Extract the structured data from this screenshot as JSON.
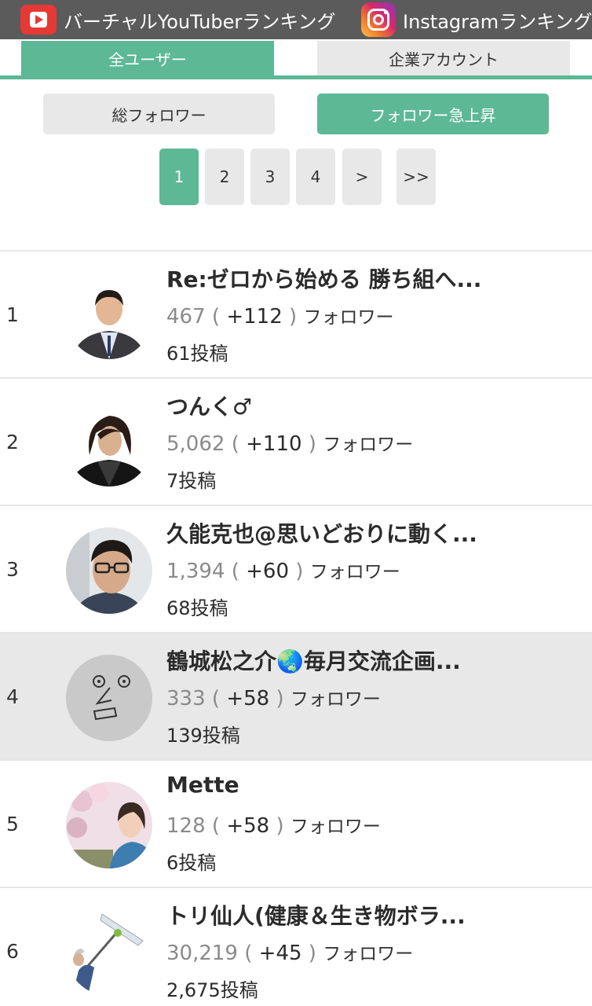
{
  "banner": {
    "youtube_label": "バーチャルYouTuberランキング",
    "instagram_label": "Instagramランキング"
  },
  "tabs": [
    {
      "label": "全ユーザー",
      "active": true
    },
    {
      "label": "企業アカウント",
      "active": false
    }
  ],
  "sort": [
    {
      "label": "総フォロワー",
      "active": false
    },
    {
      "label": "フォロワー急上昇",
      "active": true
    }
  ],
  "pagination": [
    "1",
    "2",
    "3",
    "4",
    ">",
    ">>"
  ],
  "pagination_current": "1",
  "colors": {
    "accent": "#5db895",
    "banner": "#5b5b5b",
    "highlight_row": "#e8e8e8"
  },
  "rows": [
    {
      "rank": "1",
      "name": "Re:ゼロから始める 勝ち組へ...",
      "total": "467",
      "increase": "+112",
      "unit": "フォロワー",
      "posts": "61投稿",
      "highlighted": false
    },
    {
      "rank": "2",
      "name": "つんく♂",
      "total": "5,062",
      "increase": "+110",
      "unit": "フォロワー",
      "posts": "7投稿",
      "highlighted": false
    },
    {
      "rank": "3",
      "name": "久能克也@思いどおりに動く...",
      "total": "1,394",
      "increase": "+60",
      "unit": "フォロワー",
      "posts": "68投稿",
      "highlighted": false
    },
    {
      "rank": "4",
      "name": "鶴城松之介🌏毎月交流企画...",
      "total": "333",
      "increase": "+58",
      "unit": "フォロワー",
      "posts": "139投稿",
      "highlighted": true
    },
    {
      "rank": "5",
      "name": "Mette",
      "total": "128",
      "increase": "+58",
      "unit": "フォロワー",
      "posts": "6投稿",
      "highlighted": false
    },
    {
      "rank": "6",
      "name": "トリ仙人(健康＆生き物ボラ...",
      "total": "30,219",
      "increase": "+45",
      "unit": "フォロワー",
      "posts": "2,675投稿",
      "highlighted": false
    }
  ]
}
